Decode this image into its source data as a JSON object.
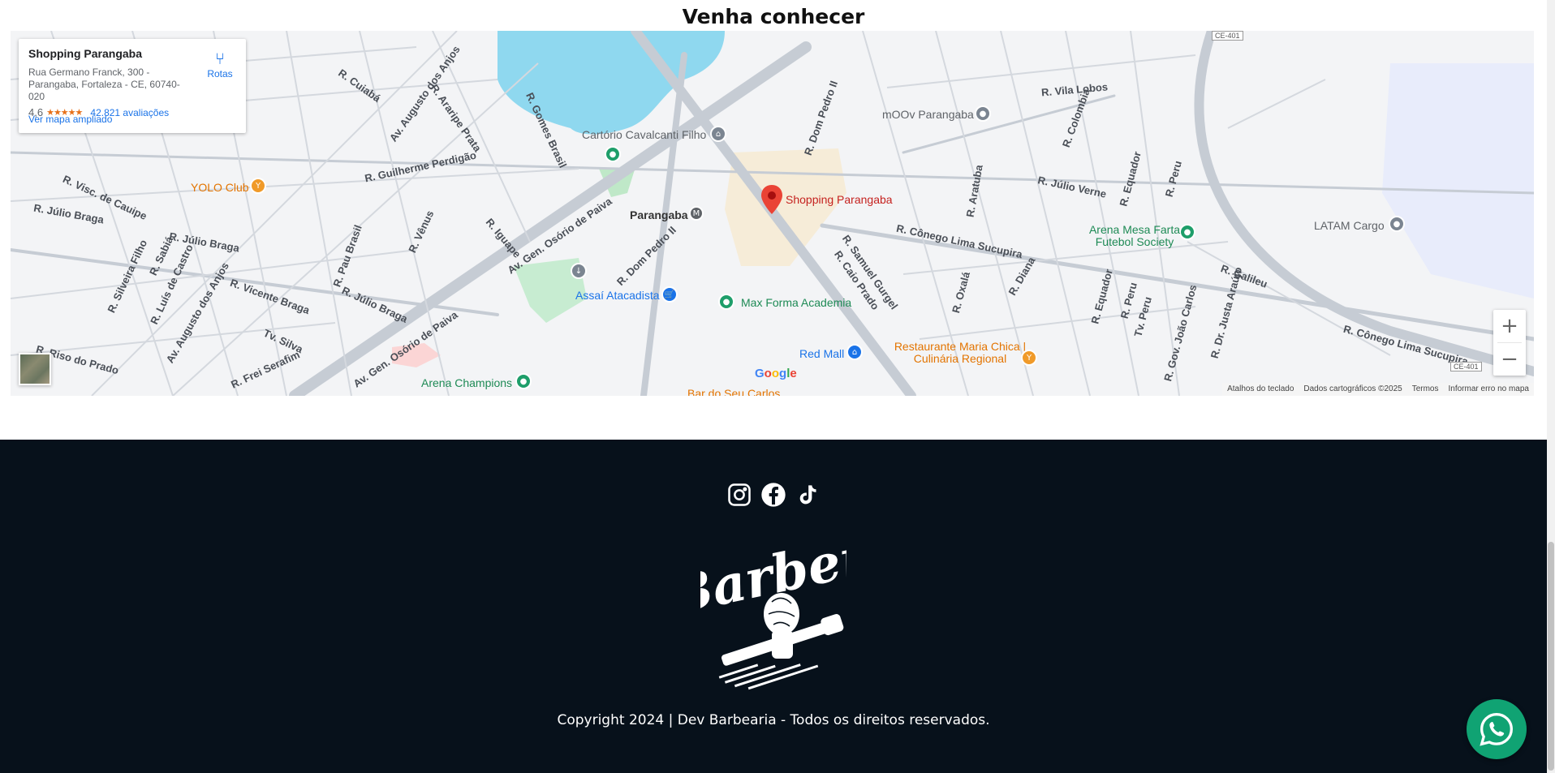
{
  "section": {
    "title": "Venha conhecer"
  },
  "map": {
    "place": {
      "name": "Shopping Parangaba",
      "address": "Rua Germano Franck, 300 - Parangaba, Fortaleza - CE, 60740-020",
      "rating": "4,6",
      "stars": "★★★★★",
      "reviews": "42.821 avaliações",
      "larger_map": "Ver mapa ampliado",
      "directions": "Rotas"
    },
    "streets": [
      "R. Cuiabá",
      "Av. Augusto dos Anjos",
      "R. Araripe Prata",
      "R. Gomes Brasil",
      "R. Guilherme Perdigão",
      "R. Visc. de Cauipe",
      "R. Júlio Braga",
      "R. Júlio Braga",
      "R. Júlio Braga",
      "R. Silveira Filho",
      "R. Sabiá",
      "R. Luís de Castro",
      "Av. Augusto dos Anjos",
      "R. Vicente Braga",
      "R. Pau Brasil",
      "R. Vênus",
      "R. Iguape",
      "Av. Gen. Osório de Paiva",
      "Av. Gen. Osório de Paiva",
      "R. Dom Pedro II",
      "R. Dom Pedro II",
      "R. Vila Lobos",
      "R. Colombia",
      "R. Júlio Verne",
      "R. Equador",
      "R. Peru",
      "R. Cônego Lima Sucupira",
      "R. Samuel Gurgel",
      "R. Caio Prado",
      "R. Oxalá",
      "R. Diana",
      "R. Galileu",
      "R. Cônego Lima Sucupira",
      "R. Dr. Justa Araújo",
      "R. Gov. João Carlos",
      "R. Riso do Prado",
      "R. Frei Serafim",
      "Tv. Silva",
      "R. Aratuba",
      "R. Equador",
      "R. Peru",
      "Tv. Peru"
    ],
    "pois": {
      "cartorio": "Cartório Cavalcanti Filho",
      "moov": "mOOv Parangaba",
      "yolo": "YOLO Club",
      "parangaba": "Parangaba",
      "shopping": "Shopping Parangaba",
      "arena_mesa": "Arena Mesa Farta Futebol Society",
      "latam": "LATAM Cargo",
      "assai": "Assaí Atacadista",
      "max_forma": "Max Forma Academia",
      "red_mall": "Red Mall",
      "restaurante": "Restaurante Maria Chica | Culinária Regional",
      "arena_champions": "Arena Champions",
      "bar": "Bar do Seu Carlos"
    },
    "route_badges": [
      "CE-401",
      "CE-401"
    ],
    "zoom_in": "+",
    "zoom_out": "−",
    "google": [
      "G",
      "o",
      "o",
      "g",
      "l",
      "e"
    ],
    "attribution": {
      "shortcuts": "Atalhos do teclado",
      "data": "Dados cartográficos ©2025",
      "terms": "Termos",
      "report": "Informar erro no mapa"
    }
  },
  "footer": {
    "logo_text": "Barber",
    "copyright": "Copyright 2024 | Dev Barbearia - Todos os direitos reservados."
  },
  "icons": {
    "instagram": "instagram-icon",
    "facebook": "facebook-icon",
    "tiktok": "tiktok-icon",
    "whatsapp": "whatsapp-icon"
  }
}
